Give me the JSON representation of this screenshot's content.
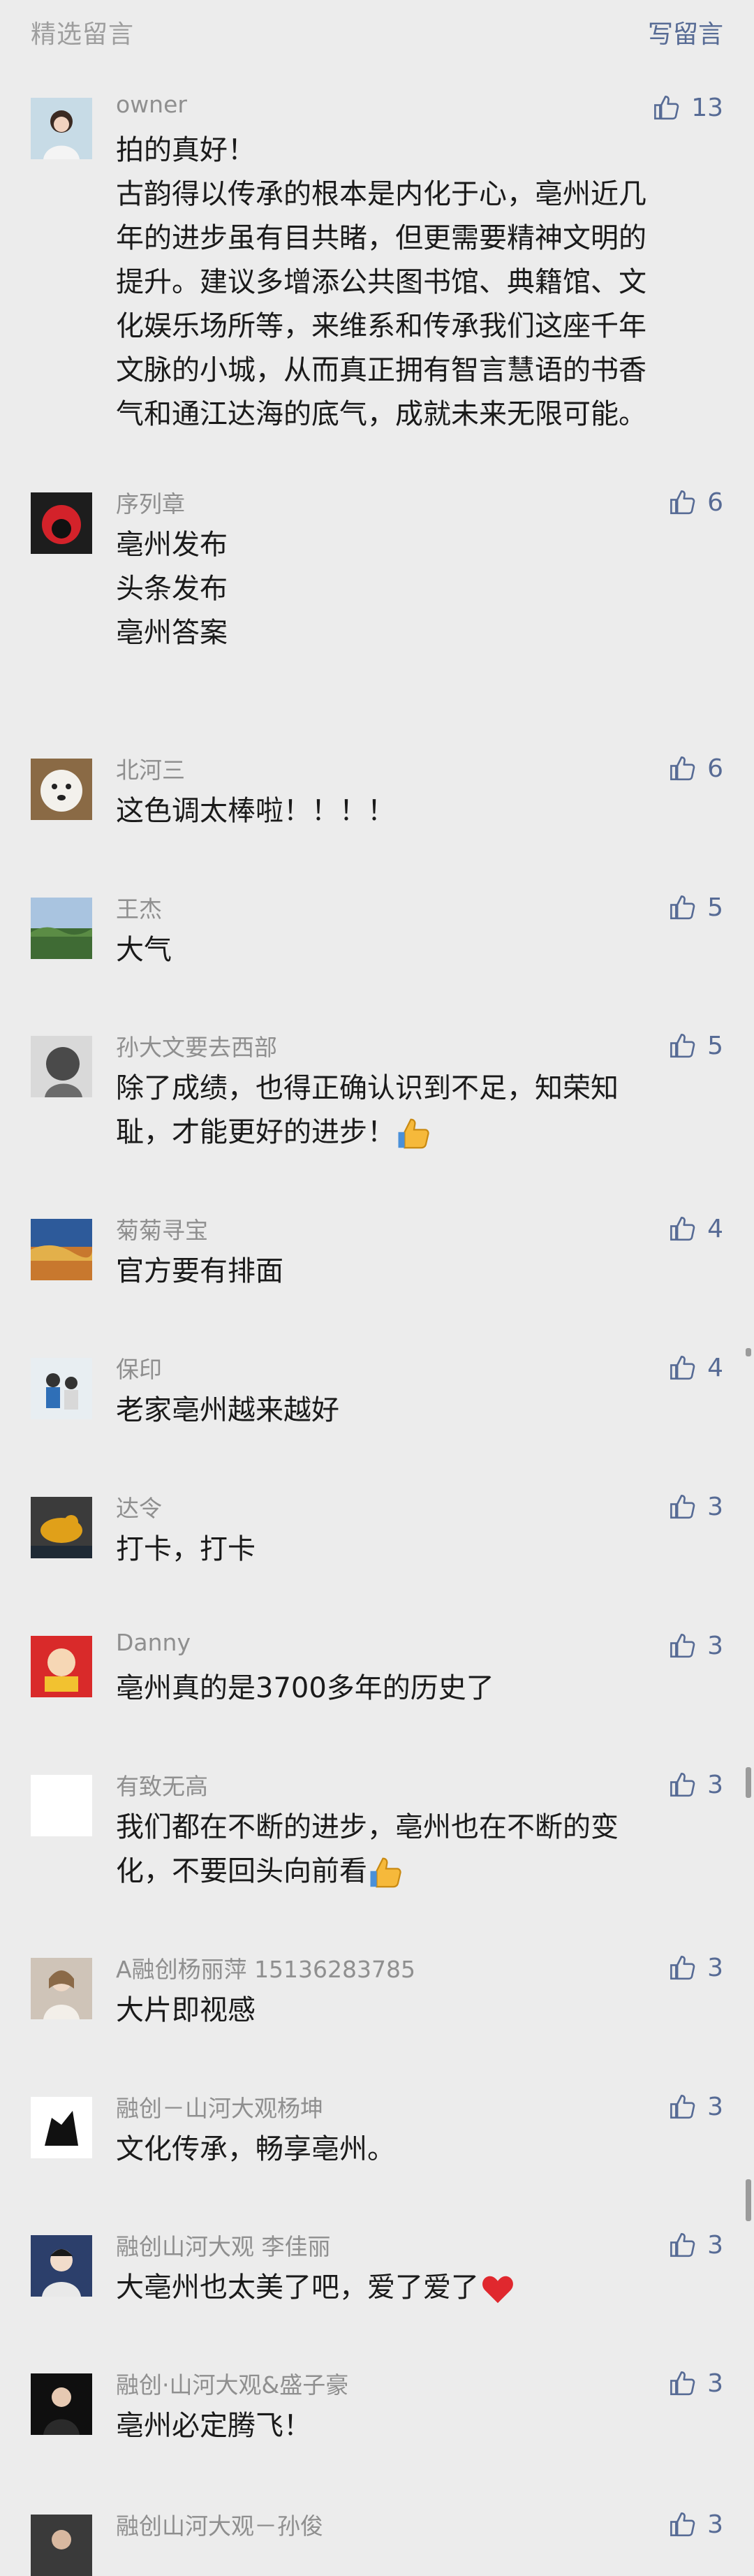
{
  "header": {
    "title": "精选留言",
    "write_label": "写留言"
  },
  "icons": {
    "like": "thumb-up-icon",
    "emoji_thumb": "thumbs-up-emoji",
    "emoji_heart": "red-heart-emoji"
  },
  "colors": {
    "accent": "#576b95",
    "nickname": "#8f8f8f",
    "background": "#ececec"
  },
  "comments": [
    {
      "nick": "owner",
      "likes": "13",
      "lines": [
        "拍的真好！",
        "古韵得以传承的根本是内化于心，亳州近几",
        "年的进步虽有目共睹，但更需要精神文明的",
        "提升。建议多增添公共图书馆、典籍馆、文",
        "化娱乐场所等，来维系和传承我们这座千年",
        "文脉的小城，从而真正拥有智言慧语的书香",
        "气和通江达海的底气，成就未来无限可能。"
      ]
    },
    {
      "nick": "序列章",
      "likes": "6",
      "lines": [
        "亳州发布",
        "头条发布",
        "亳州答案"
      ]
    },
    {
      "nick": "北河三",
      "likes": "6",
      "lines": [
        "这色调太棒啦！！！！"
      ]
    },
    {
      "nick": "王杰",
      "likes": "5",
      "lines": [
        "大气"
      ]
    },
    {
      "nick": "孙大文要去西部",
      "likes": "5",
      "lines": [
        "除了成绩，也得正确认识到不足，知荣知",
        "耻，才能更好的进步！"
      ]
    },
    {
      "nick": "菊菊寻宝",
      "likes": "4",
      "lines": [
        "官方要有排面"
      ]
    },
    {
      "nick": "保印",
      "likes": "4",
      "lines": [
        "老家亳州越来越好"
      ]
    },
    {
      "nick": "达令",
      "likes": "3",
      "lines": [
        "打卡，打卡"
      ]
    },
    {
      "nick": "Danny",
      "likes": "3",
      "lines": [
        "亳州真的是3700多年的历史了"
      ]
    },
    {
      "nick": "有致无高",
      "likes": "3",
      "lines": [
        "我们都在不断的进步，亳州也在不断的变",
        "化，不要回头向前看"
      ]
    },
    {
      "nick": "A融创杨丽萍 15136283785",
      "likes": "3",
      "lines": [
        "大片即视感"
      ]
    },
    {
      "nick": "融创－山河大观杨坤",
      "likes": "3",
      "lines": [
        "文化传承，畅享亳州。"
      ]
    },
    {
      "nick": "融创山河大观 李佳丽",
      "likes": "3",
      "lines": [
        "大亳州也太美了吧，爱了爱了"
      ]
    },
    {
      "nick": "融创·山河大观&盛子豪",
      "likes": "3",
      "lines": [
        "亳州必定腾飞！"
      ]
    },
    {
      "nick": "融创山河大观－孙俊",
      "likes": "3",
      "lines": []
    }
  ]
}
